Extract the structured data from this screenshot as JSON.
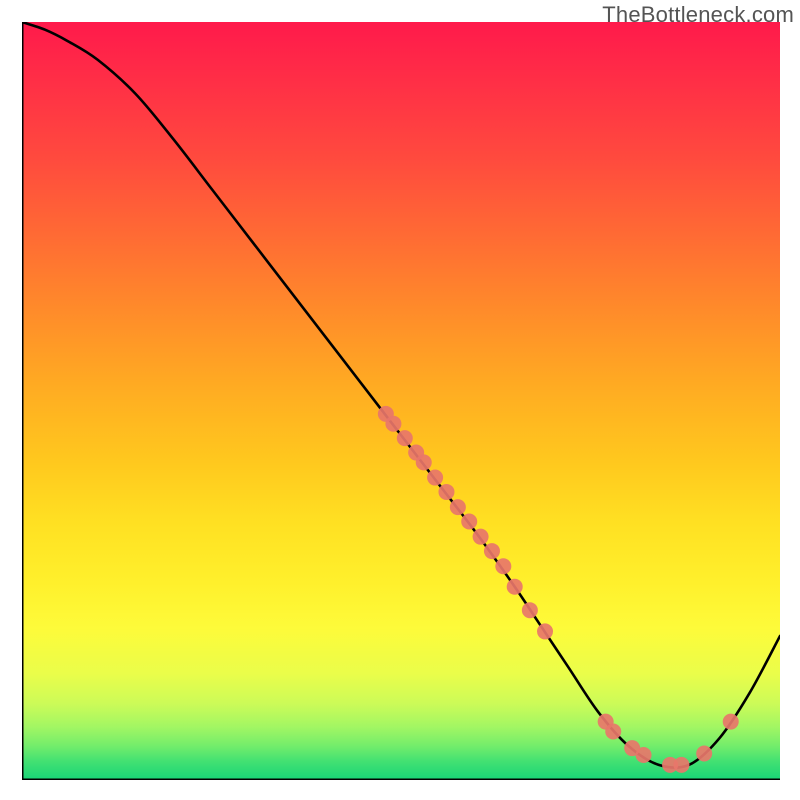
{
  "watermark": "TheBottleneck.com",
  "chart_data": {
    "type": "line",
    "title": "",
    "xlabel": "",
    "ylabel": "",
    "xlim": [
      0,
      100
    ],
    "ylim": [
      0,
      100
    ],
    "series": [
      {
        "name": "curve",
        "x": [
          0,
          3,
          6,
          10,
          15,
          20,
          25,
          30,
          35,
          40,
          45,
          50,
          55,
          60,
          65,
          68,
          72,
          76,
          80,
          84,
          88,
          92,
          96,
          100
        ],
        "y": [
          100,
          99,
          97.5,
          95,
          90.5,
          84.5,
          78,
          71.5,
          65,
          58.5,
          52,
          45.5,
          39,
          32.5,
          25.5,
          21,
          15,
          9,
          4.5,
          2,
          2,
          5.5,
          11.5,
          19
        ]
      }
    ],
    "scatter_points": {
      "x": [
        48,
        49,
        50.5,
        52,
        53,
        54.5,
        56,
        57.5,
        59,
        60.5,
        62,
        63.5,
        65,
        67,
        69,
        77,
        78,
        80.5,
        82,
        85.5,
        87,
        90,
        93.5
      ],
      "y": [
        48.3,
        47,
        45.1,
        43.2,
        41.9,
        39.9,
        38,
        36,
        34.1,
        32.1,
        30.2,
        28.2,
        25.5,
        22.4,
        19.6,
        7.7,
        6.4,
        4.2,
        3.3,
        2,
        2,
        3.5,
        7.7
      ]
    },
    "gradient_stops": [
      {
        "offset": 0.0,
        "color": "#ff1a4b"
      },
      {
        "offset": 0.08,
        "color": "#ff2f46"
      },
      {
        "offset": 0.18,
        "color": "#ff4a3e"
      },
      {
        "offset": 0.28,
        "color": "#ff6a34"
      },
      {
        "offset": 0.38,
        "color": "#ff8b2a"
      },
      {
        "offset": 0.48,
        "color": "#ffab22"
      },
      {
        "offset": 0.58,
        "color": "#ffc81e"
      },
      {
        "offset": 0.66,
        "color": "#ffe022"
      },
      {
        "offset": 0.74,
        "color": "#fff02c"
      },
      {
        "offset": 0.8,
        "color": "#fdfb3a"
      },
      {
        "offset": 0.86,
        "color": "#eafd4a"
      },
      {
        "offset": 0.9,
        "color": "#cbfb58"
      },
      {
        "offset": 0.93,
        "color": "#a2f663"
      },
      {
        "offset": 0.955,
        "color": "#73ed6b"
      },
      {
        "offset": 0.975,
        "color": "#43e172"
      },
      {
        "offset": 1.0,
        "color": "#17d477"
      }
    ],
    "axis_color": "#000000",
    "curve_stroke": "#000000",
    "point_fill": "#e8766a",
    "point_stroke": "#c95a50"
  }
}
